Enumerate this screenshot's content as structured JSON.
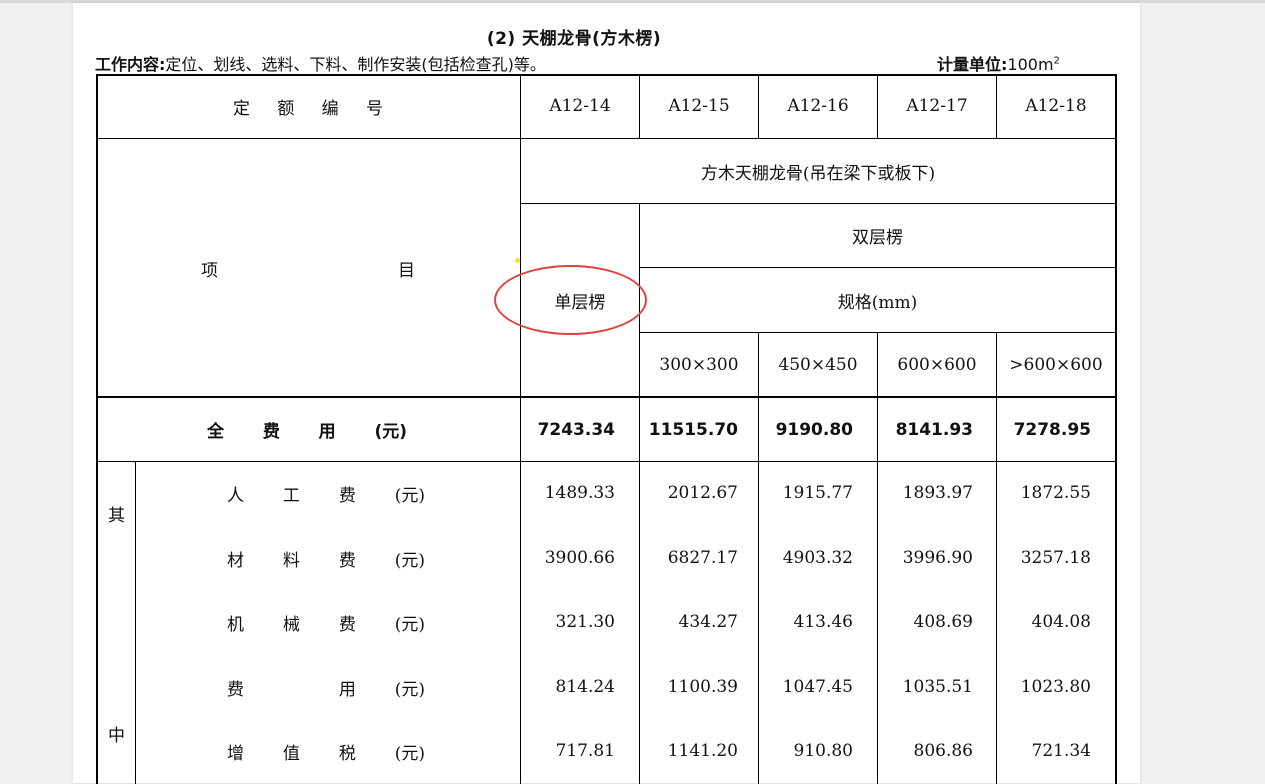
{
  "doc": {
    "title": "(2) 天棚龙骨(方木楞)",
    "work_label": "工作内容:",
    "work_text": "定位、划线、选料、下料、制作安装(包括检查孔)等。",
    "unit_label": "计量单位:",
    "unit_value": "100m",
    "unit_sup": "2"
  },
  "table": {
    "code_header": [
      "定",
      "额",
      "编",
      "号"
    ],
    "codes": [
      "A12-14",
      "A12-15",
      "A12-16",
      "A12-17",
      "A12-18"
    ],
    "item_header": [
      "项",
      "目"
    ],
    "group_header": "方木天棚龙骨(吊在梁下或板下)",
    "single_layer": "单层楞",
    "double_layer": "双层楞",
    "spec_label": "规格(mm)",
    "specs": [
      "300×300",
      "450×450",
      "600×600",
      ">600×600"
    ],
    "total_label": [
      "全",
      "费",
      "用",
      "(元)"
    ],
    "totals": [
      "7243.34",
      "11515.70",
      "9190.80",
      "8141.93",
      "7278.95"
    ],
    "side_label_top": "其",
    "side_label_bottom": "中",
    "rows": [
      {
        "label": [
          "人",
          "工",
          "费",
          "(元)"
        ],
        "values": [
          "1489.33",
          "2012.67",
          "1915.77",
          "1893.97",
          "1872.55"
        ]
      },
      {
        "label": [
          "材",
          "料",
          "费",
          "(元)"
        ],
        "values": [
          "3900.66",
          "6827.17",
          "4903.32",
          "3996.90",
          "3257.18"
        ]
      },
      {
        "label": [
          "机",
          "械",
          "费",
          "(元)"
        ],
        "values": [
          "321.30",
          "434.27",
          "413.46",
          "408.69",
          "404.08"
        ]
      },
      {
        "label": [
          "费",
          "",
          "用",
          "(元)"
        ],
        "values": [
          "814.24",
          "1100.39",
          "1047.45",
          "1035.51",
          "1023.80"
        ]
      },
      {
        "label": [
          "增",
          "值",
          "税",
          "(元)"
        ],
        "values": [
          "717.81",
          "1141.20",
          "910.80",
          "806.86",
          "721.34"
        ]
      }
    ]
  }
}
